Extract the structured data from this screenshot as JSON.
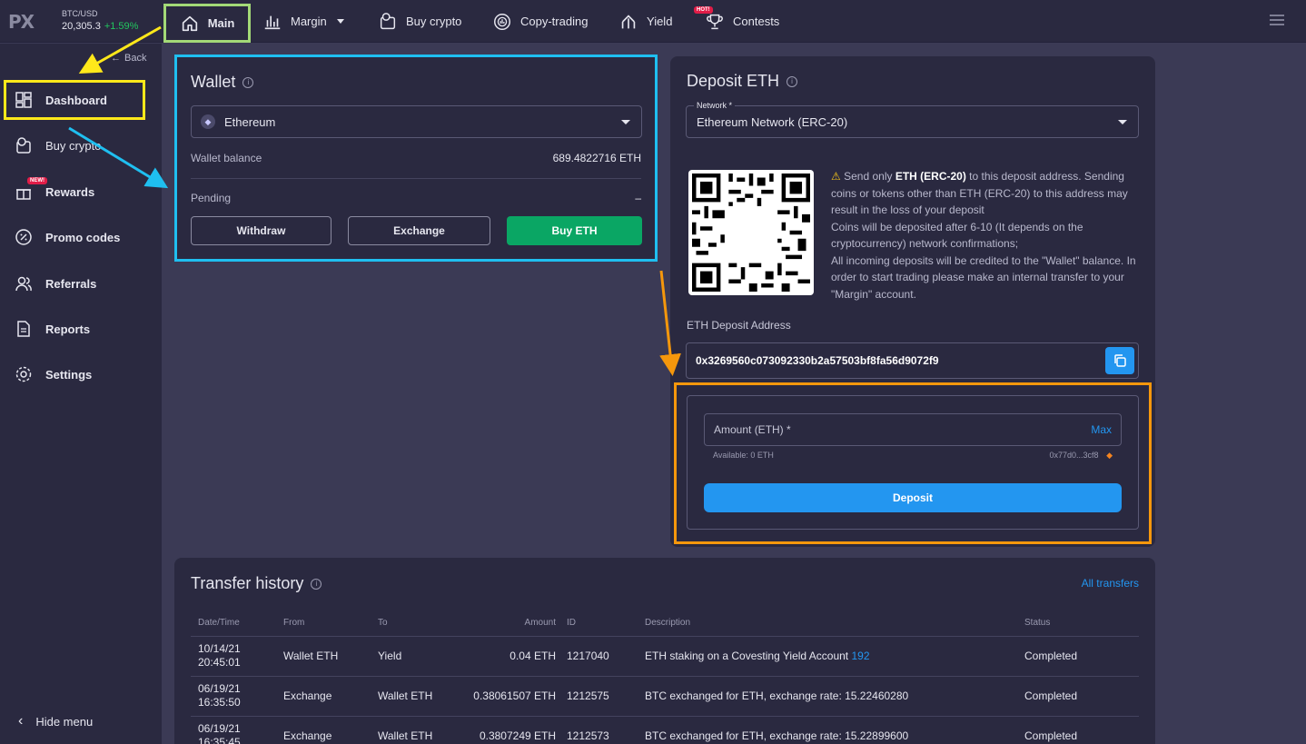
{
  "topbar": {
    "logo": "PX",
    "ticker": {
      "pair": "BTC/USD",
      "price": "20,305.3",
      "change": "+1.59%"
    },
    "nav": [
      {
        "label": "Main"
      },
      {
        "label": "Margin"
      },
      {
        "label": "Buy crypto"
      },
      {
        "label": "Copy-trading"
      },
      {
        "label": "Yield"
      },
      {
        "label": "Contests",
        "badge": "HOT!"
      }
    ]
  },
  "sidebar": {
    "back_label": "Back",
    "items": [
      {
        "label": "Dashboard"
      },
      {
        "label": "Buy crypto"
      },
      {
        "label": "Rewards",
        "badge": "NEW!"
      },
      {
        "label": "Promo codes"
      },
      {
        "label": "Referrals"
      },
      {
        "label": "Reports"
      },
      {
        "label": "Settings"
      }
    ],
    "hide_menu": "Hide menu"
  },
  "wallet": {
    "title": "Wallet",
    "currency": "Ethereum",
    "balance_label": "Wallet balance",
    "balance_value": "689.4822716 ETH",
    "pending_label": "Pending",
    "pending_value": "–",
    "withdraw": "Withdraw",
    "exchange": "Exchange",
    "buy": "Buy ETH"
  },
  "deposit": {
    "title": "Deposit ETH",
    "network_label": "Network *",
    "network_value": "Ethereum Network (ERC-20)",
    "warning_prefix": "Send only ",
    "warning_bold": "ETH (ERC-20)",
    "warning_rest": " to this deposit address. Sending coins or tokens other than ETH (ERC-20) to this address may result in the loss of your deposit",
    "notes": [
      "Coins will be deposited after 6-10 (It depends on the cryptocurrency) network confirmations;",
      "All incoming deposits will be credited to the \"Wallet\" balance. In order to start trading please make an internal transfer to your \"Margin\" account."
    ],
    "address_label": "ETH Deposit Address",
    "address": "0x3269560c073092330b2a57503bf8fa56d9072f9",
    "amount_placeholder": "Amount (ETH) *",
    "max_label": "Max",
    "available": "Available: 0 ETH",
    "wallet_short": "0x77d0...3cf8",
    "deposit_button": "Deposit"
  },
  "history": {
    "title": "Transfer history",
    "all_link": "All transfers",
    "columns": [
      "Date/Time",
      "From",
      "To",
      "Amount",
      "ID",
      "Description",
      "Status"
    ],
    "rows": [
      {
        "date": "10/14/21",
        "time": "20:45:01",
        "from": "Wallet ETH",
        "to": "Yield",
        "amount": "0.04 ETH",
        "id": "1217040",
        "desc": "ETH staking on a Covesting Yield Account ",
        "desc_link": "192",
        "status": "Completed"
      },
      {
        "date": "06/19/21",
        "time": "16:35:50",
        "from": "Exchange",
        "to": "Wallet ETH",
        "amount": "0.38061507 ETH",
        "id": "1212575",
        "desc": "BTC exchanged for ETH, exchange rate: 15.22460280",
        "desc_link": "",
        "status": "Completed"
      },
      {
        "date": "06/19/21",
        "time": "16:35:45",
        "from": "Exchange",
        "to": "Wallet ETH",
        "amount": "0.3807249 ETH",
        "id": "1212573",
        "desc": "BTC exchanged for ETH, exchange rate: 15.22899600",
        "desc_link": "",
        "status": "Completed"
      }
    ]
  },
  "colors": {
    "accent_blue": "#2396f0",
    "green": "#0aa664",
    "highlight_yellow": "#ffe81a",
    "highlight_cyan": "#1fbff0",
    "highlight_orange": "#f5970c",
    "highlight_lightgreen": "#a3d977"
  }
}
